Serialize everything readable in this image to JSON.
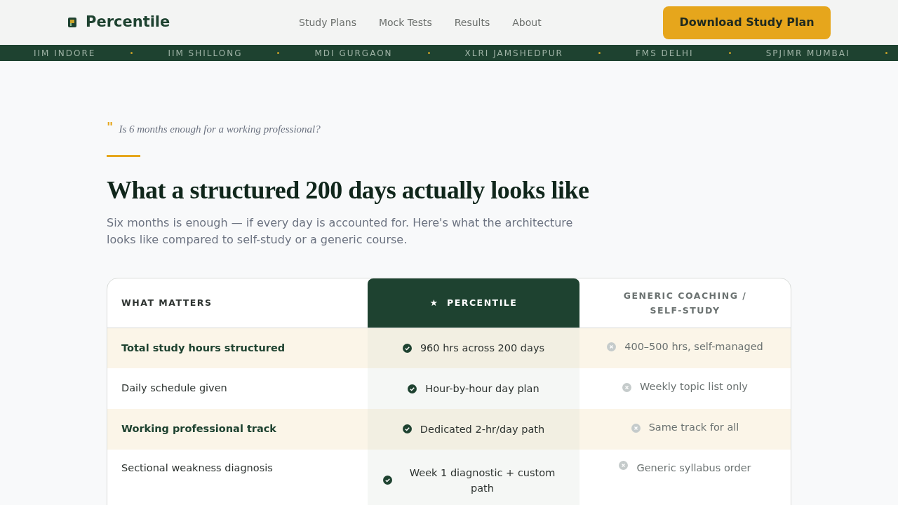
{
  "brand": {
    "name": "Percentile"
  },
  "nav": [
    "Study Plans",
    "Mock Tests",
    "Results",
    "About"
  ],
  "cta": "Download Study Plan",
  "ticker": [
    "IIM INDORE",
    "IIM SHILLONG",
    "MDI GURGAON",
    "XLRI JAMSHEDPUR",
    "FMS DELHI",
    "SPJIMR MUMBAI"
  ],
  "quote": {
    "mark": "\"",
    "text": "Is 6 months enough for a working professional?"
  },
  "heading": "What a structured 200 days actually looks like",
  "intro": "Six months is enough — if every day is accounted for. Here's what the architecture looks like compared to self-study or a generic course.",
  "table": {
    "columns": [
      {
        "label": "WHAT MATTERS",
        "featured": false
      },
      {
        "label": "PERCENTILE",
        "featured": true,
        "mark": "★"
      },
      {
        "label": "GENERIC COACHING / SELF-STUDY",
        "featured": false
      }
    ],
    "rows": [
      {
        "feature": "Total study hours structured",
        "highlighted": true,
        "percentile": "960 hrs across 200 days",
        "generic": "400–500 hrs, self-managed"
      },
      {
        "feature": "Daily schedule given",
        "highlighted": false,
        "percentile": "Hour-by-hour day plan",
        "generic": "Weekly topic list only"
      },
      {
        "feature": "Working professional track",
        "highlighted": true,
        "percentile": "Dedicated 2-hr/day path",
        "generic": "Same track for all"
      },
      {
        "feature": "Sectional weakness diagnosis",
        "highlighted": false,
        "percentile": "Week 1 diagnostic + custom path",
        "generic": "Generic syllabus order"
      }
    ]
  }
}
